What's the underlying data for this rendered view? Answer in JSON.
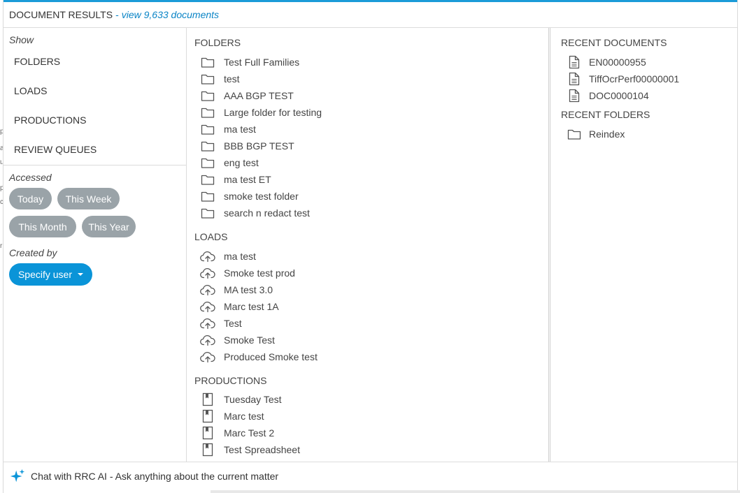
{
  "header": {
    "title": "DOCUMENT RESULTS",
    "separator": "-",
    "view_link": "view 9,633 documents"
  },
  "filters": {
    "show_label": "Show",
    "show_items": [
      "FOLDERS",
      "LOADS",
      "PRODUCTIONS",
      "REVIEW QUEUES"
    ],
    "accessed_label": "Accessed",
    "accessed_options": [
      "Today",
      "This Week",
      "This Month",
      "This Year"
    ],
    "created_by_label": "Created by",
    "specify_user_label": "Specify user"
  },
  "folders": {
    "title": "FOLDERS",
    "items": [
      "Test Full Families",
      "test",
      "AAA BGP TEST",
      "Large folder for testing",
      "ma test",
      "BBB BGP TEST",
      "eng test",
      "ma test ET",
      "smoke test folder",
      "search n redact test"
    ]
  },
  "loads": {
    "title": "LOADS",
    "items": [
      "ma test",
      "Smoke test prod",
      "MA test 3.0",
      "Marc test 1A",
      "Test",
      "Smoke Test",
      "Produced Smoke test"
    ]
  },
  "productions": {
    "title": "PRODUCTIONS",
    "items": [
      "Tuesday Test",
      "Marc test",
      "Marc Test 2",
      "Test Spreadsheet"
    ]
  },
  "recent_documents": {
    "title": "RECENT DOCUMENTS",
    "items": [
      "EN00000955",
      "TiffOcrPerf00000001",
      "DOC0000104"
    ]
  },
  "recent_folders": {
    "title": "RECENT FOLDERS",
    "items": [
      "Reindex"
    ]
  },
  "footer": {
    "chat_label": "Chat with RRC AI - Ask anything about the current matter"
  },
  "icons": {
    "folder": "folder-icon",
    "load": "cloud-upload-icon",
    "production": "production-icon",
    "document": "document-icon",
    "chat": "sparkle-icon"
  },
  "colors": {
    "accent": "#0a94d8",
    "link": "#0a84c6",
    "pill": "#9aa3a8",
    "top_bar": "#1b9bd8"
  }
}
